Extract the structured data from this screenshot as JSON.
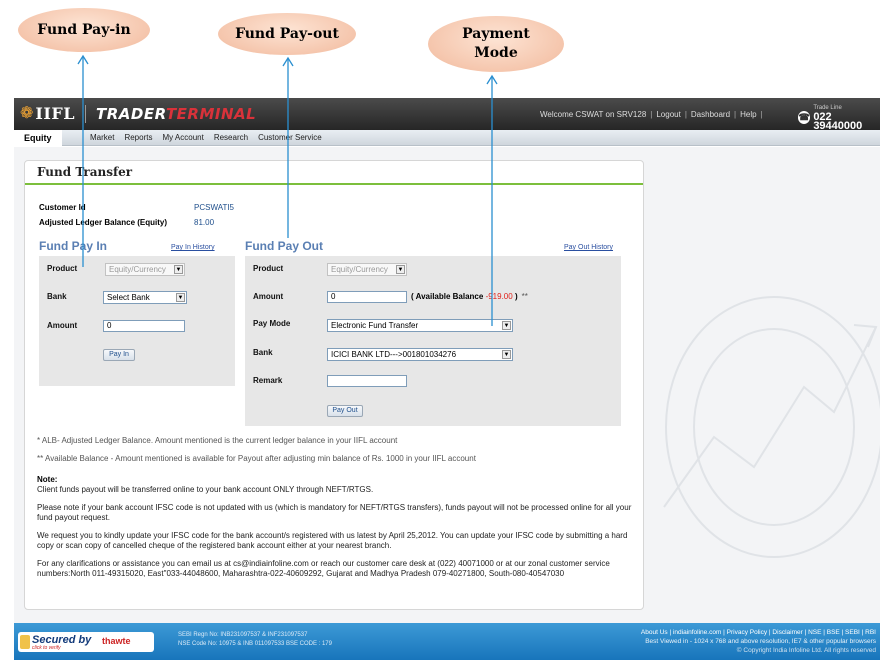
{
  "callouts": {
    "fund_pay_in": "Fund Pay-in",
    "fund_pay_out": "Fund Pay-out",
    "payment_mode_line1": "Payment",
    "payment_mode_line2": "Mode"
  },
  "header": {
    "logo_iifl": "IIFL",
    "logo_trader_a": "TRADER",
    "logo_trader_b": "TERMINAL",
    "welcome": "Welcome CSWAT on SRV128",
    "logout": "Logout",
    "dashboard": "Dashboard",
    "help": "Help",
    "trade_line_label": "Trade Line",
    "trade_line_number": "022 39440000"
  },
  "menu": {
    "active_tab": "Equity",
    "items": [
      "Market",
      "Reports",
      "My Account",
      "Research",
      "Customer Service"
    ]
  },
  "panel": {
    "title": "Fund Transfer",
    "customer_id_label": "Customer Id",
    "customer_id_value": "PCSWATI5",
    "alb_label": "Adjusted Ledger Balance (Equity)",
    "alb_value": "81.00"
  },
  "pay_in": {
    "title": "Fund Pay In",
    "history_link": "Pay In History",
    "product_label": "Product",
    "product_value": "Equity/Currency",
    "bank_label": "Bank",
    "bank_value": "Select Bank",
    "amount_label": "Amount",
    "amount_value": "0",
    "button": "Pay In"
  },
  "pay_out": {
    "title": "Fund Pay Out",
    "history_link": "Pay Out History",
    "product_label": "Product",
    "product_value": "Equity/Currency",
    "amount_label": "Amount",
    "amount_value": "0",
    "available_prefix": "( Available Balance",
    "available_value": "-919.00",
    "available_suffix": ")",
    "available_stars": "**",
    "paymode_label": "Pay Mode",
    "paymode_value": "Electronic Fund Transfer",
    "bank_label": "Bank",
    "bank_value": "ICICI BANK LTD--->001801034276",
    "remark_label": "Remark",
    "remark_value": "",
    "button": "Pay Out"
  },
  "notes": {
    "alb_note": "* ALB- Adjusted Ledger Balance. Amount mentioned is the current ledger balance in your IIFL account",
    "avail_note": "** Available Balance - Amount mentioned is available for Payout after adjusting min balance of Rs. 1000 in your IIFL account",
    "note_head": "Note:",
    "p1": "Client funds payout will be transferred online to your bank account ONLY through NEFT/RTGS.",
    "p2": "Please note if your bank account IFSC code is not updated with us (which is mandatory for NEFT/RTGS transfers), funds payout will not be processed online for all your fund payout request.",
    "p3": "We request you to kindly update your IFSC code for the bank account/s registered with us latest by April 25,2012. You can update your IFSC code by submitting a hard copy or scan copy of cancelled cheque of the registered bank account either at your nearest branch.",
    "p4": "For any clarifications or assistance you can email us at cs@indiainfoline.com or reach our customer care desk at (022) 40071000 or at our zonal customer service numbers:North 011-49315020, East\"033-44048600, Maharashtra-022-40609292, Gujarat and Madhya Pradesh 079-40271800, South-080-40547030"
  },
  "footer": {
    "secured_by": "Secured by",
    "thawte": "thawte",
    "click_to_verify": "click to verify",
    "sebi_line1": "SEBI Regn No: INB231097537 & INF231097537",
    "sebi_line2": "NSE Code No: 10975 & INB 011097533 BSE CODE : 179",
    "links": "About Us  |  indiainfoline.com  |  Privacy Policy  |  Disclaimer  |  NSE  |  BSE  |  SEBI  |  RBI",
    "best_viewed": "Best Viewed in - 1024 x 768 and above resolution, IE7 & other popular browsers",
    "copyright": "© Copyright India Infoline Ltd. All rights reserved"
  }
}
